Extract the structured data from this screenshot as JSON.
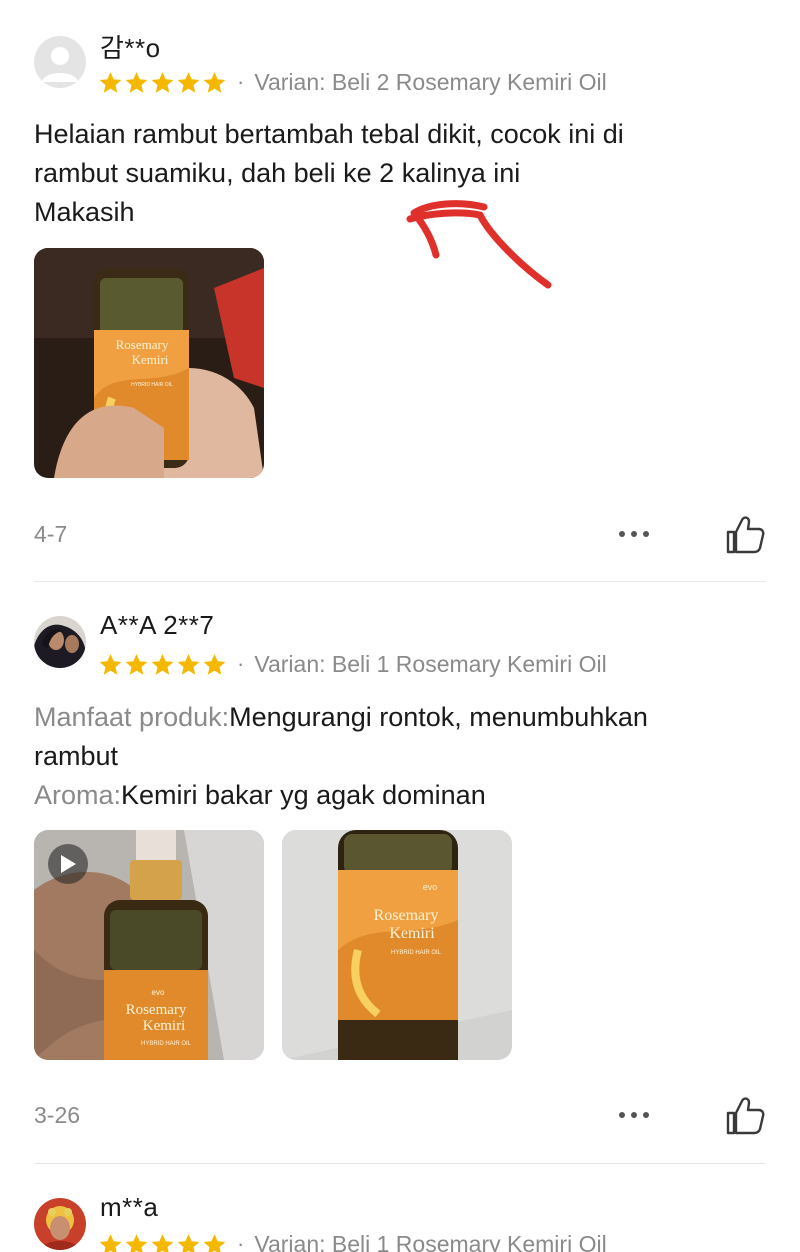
{
  "reviews": [
    {
      "username": "감**o",
      "rating": 5,
      "variant": "Varian: Beli 2 Rosemary Kemiri Oil",
      "text_lines": [
        "Helaian rambut bertambah tebal dikit, cocok ini di",
        "rambut suamiku, dah beli ke 2 kalinya ini",
        "Makasih"
      ],
      "date": "4-7"
    },
    {
      "username": "A**A 2**7",
      "rating": 5,
      "variant": "Varian: Beli 1 Rosemary Kemiri Oil",
      "benefit_label": "Manfaat produk:",
      "benefit_value_line1": "Mengurangi rontok, menumbuhkan",
      "benefit_value_line2": "rambut",
      "aroma_label": "Aroma:",
      "aroma_value": "Kemiri bakar yg agak dominan",
      "date": "3-26"
    },
    {
      "username": "m**a",
      "rating": 5,
      "variant": "Varian: Beli 1 Rosemary Kemiri Oil"
    }
  ],
  "product_label": {
    "line1": "Rosemary",
    "line2": "Kemiri",
    "sub": "HYBRID HAIR OIL",
    "brand": "evo"
  },
  "colors": {
    "star": "#F5B800",
    "muted_text": "#8A8A8A",
    "annotation_arrow": "#E0302C",
    "divider": "#E6E6E6"
  },
  "icons": [
    "avatar-placeholder-icon",
    "star-icon",
    "more-options-icon",
    "thumbs-up-icon",
    "play-icon"
  ]
}
